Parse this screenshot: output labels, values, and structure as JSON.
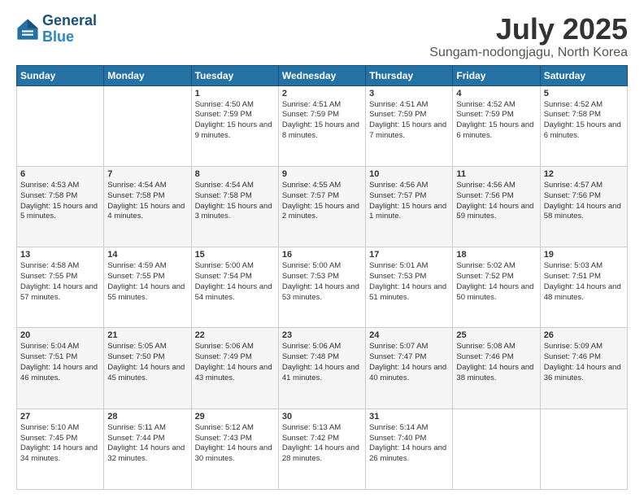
{
  "logo": {
    "line1": "General",
    "line2": "Blue"
  },
  "title": "July 2025",
  "location": "Sungam-nodongjagu, North Korea",
  "weekdays": [
    "Sunday",
    "Monday",
    "Tuesday",
    "Wednesday",
    "Thursday",
    "Friday",
    "Saturday"
  ],
  "weeks": [
    [
      {
        "day": "",
        "text": ""
      },
      {
        "day": "",
        "text": ""
      },
      {
        "day": "1",
        "text": "Sunrise: 4:50 AM\nSunset: 7:59 PM\nDaylight: 15 hours and 9 minutes."
      },
      {
        "day": "2",
        "text": "Sunrise: 4:51 AM\nSunset: 7:59 PM\nDaylight: 15 hours and 8 minutes."
      },
      {
        "day": "3",
        "text": "Sunrise: 4:51 AM\nSunset: 7:59 PM\nDaylight: 15 hours and 7 minutes."
      },
      {
        "day": "4",
        "text": "Sunrise: 4:52 AM\nSunset: 7:59 PM\nDaylight: 15 hours and 6 minutes."
      },
      {
        "day": "5",
        "text": "Sunrise: 4:52 AM\nSunset: 7:58 PM\nDaylight: 15 hours and 6 minutes."
      }
    ],
    [
      {
        "day": "6",
        "text": "Sunrise: 4:53 AM\nSunset: 7:58 PM\nDaylight: 15 hours and 5 minutes."
      },
      {
        "day": "7",
        "text": "Sunrise: 4:54 AM\nSunset: 7:58 PM\nDaylight: 15 hours and 4 minutes."
      },
      {
        "day": "8",
        "text": "Sunrise: 4:54 AM\nSunset: 7:58 PM\nDaylight: 15 hours and 3 minutes."
      },
      {
        "day": "9",
        "text": "Sunrise: 4:55 AM\nSunset: 7:57 PM\nDaylight: 15 hours and 2 minutes."
      },
      {
        "day": "10",
        "text": "Sunrise: 4:56 AM\nSunset: 7:57 PM\nDaylight: 15 hours and 1 minute."
      },
      {
        "day": "11",
        "text": "Sunrise: 4:56 AM\nSunset: 7:56 PM\nDaylight: 14 hours and 59 minutes."
      },
      {
        "day": "12",
        "text": "Sunrise: 4:57 AM\nSunset: 7:56 PM\nDaylight: 14 hours and 58 minutes."
      }
    ],
    [
      {
        "day": "13",
        "text": "Sunrise: 4:58 AM\nSunset: 7:55 PM\nDaylight: 14 hours and 57 minutes."
      },
      {
        "day": "14",
        "text": "Sunrise: 4:59 AM\nSunset: 7:55 PM\nDaylight: 14 hours and 55 minutes."
      },
      {
        "day": "15",
        "text": "Sunrise: 5:00 AM\nSunset: 7:54 PM\nDaylight: 14 hours and 54 minutes."
      },
      {
        "day": "16",
        "text": "Sunrise: 5:00 AM\nSunset: 7:53 PM\nDaylight: 14 hours and 53 minutes."
      },
      {
        "day": "17",
        "text": "Sunrise: 5:01 AM\nSunset: 7:53 PM\nDaylight: 14 hours and 51 minutes."
      },
      {
        "day": "18",
        "text": "Sunrise: 5:02 AM\nSunset: 7:52 PM\nDaylight: 14 hours and 50 minutes."
      },
      {
        "day": "19",
        "text": "Sunrise: 5:03 AM\nSunset: 7:51 PM\nDaylight: 14 hours and 48 minutes."
      }
    ],
    [
      {
        "day": "20",
        "text": "Sunrise: 5:04 AM\nSunset: 7:51 PM\nDaylight: 14 hours and 46 minutes."
      },
      {
        "day": "21",
        "text": "Sunrise: 5:05 AM\nSunset: 7:50 PM\nDaylight: 14 hours and 45 minutes."
      },
      {
        "day": "22",
        "text": "Sunrise: 5:06 AM\nSunset: 7:49 PM\nDaylight: 14 hours and 43 minutes."
      },
      {
        "day": "23",
        "text": "Sunrise: 5:06 AM\nSunset: 7:48 PM\nDaylight: 14 hours and 41 minutes."
      },
      {
        "day": "24",
        "text": "Sunrise: 5:07 AM\nSunset: 7:47 PM\nDaylight: 14 hours and 40 minutes."
      },
      {
        "day": "25",
        "text": "Sunrise: 5:08 AM\nSunset: 7:46 PM\nDaylight: 14 hours and 38 minutes."
      },
      {
        "day": "26",
        "text": "Sunrise: 5:09 AM\nSunset: 7:46 PM\nDaylight: 14 hours and 36 minutes."
      }
    ],
    [
      {
        "day": "27",
        "text": "Sunrise: 5:10 AM\nSunset: 7:45 PM\nDaylight: 14 hours and 34 minutes."
      },
      {
        "day": "28",
        "text": "Sunrise: 5:11 AM\nSunset: 7:44 PM\nDaylight: 14 hours and 32 minutes."
      },
      {
        "day": "29",
        "text": "Sunrise: 5:12 AM\nSunset: 7:43 PM\nDaylight: 14 hours and 30 minutes."
      },
      {
        "day": "30",
        "text": "Sunrise: 5:13 AM\nSunset: 7:42 PM\nDaylight: 14 hours and 28 minutes."
      },
      {
        "day": "31",
        "text": "Sunrise: 5:14 AM\nSunset: 7:40 PM\nDaylight: 14 hours and 26 minutes."
      },
      {
        "day": "",
        "text": ""
      },
      {
        "day": "",
        "text": ""
      }
    ]
  ]
}
